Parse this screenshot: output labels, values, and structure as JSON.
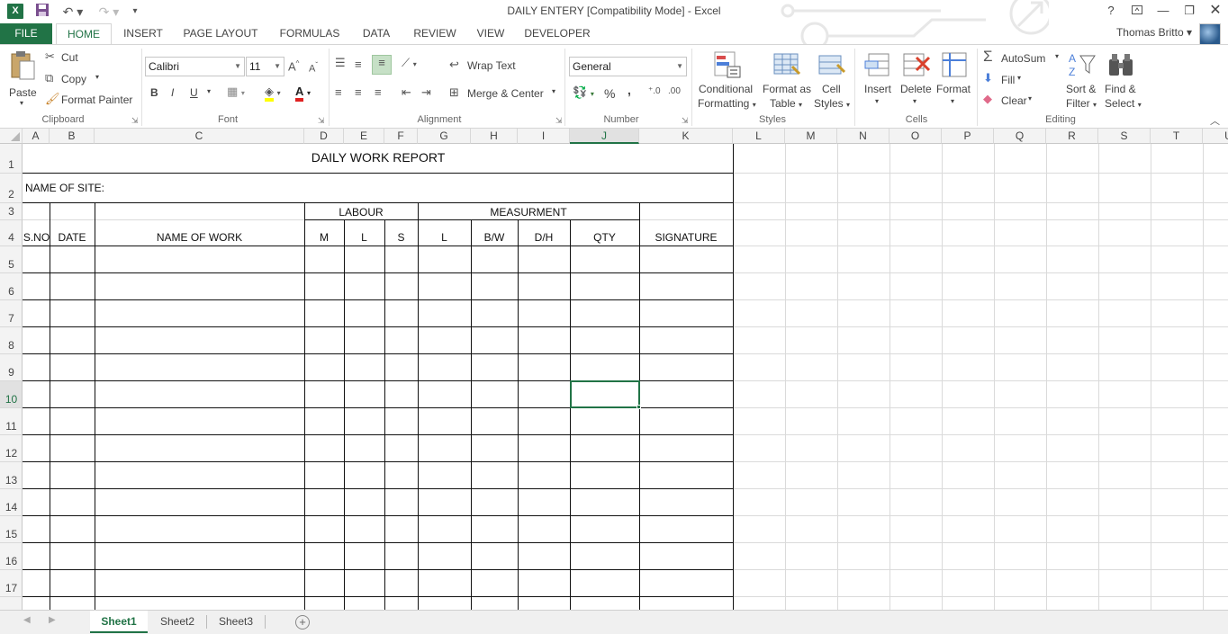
{
  "window": {
    "title": "DAILY ENTERY  [Compatibility Mode] - Excel",
    "user_name": "Thomas Britto",
    "help": "?",
    "logo_letter": "X"
  },
  "tabs": [
    "FILE",
    "HOME",
    "INSERT",
    "PAGE LAYOUT",
    "FORMULAS",
    "DATA",
    "REVIEW",
    "VIEW",
    "DEVELOPER"
  ],
  "ribbon": {
    "clipboard": {
      "label": "Clipboard",
      "paste": "Paste",
      "cut": "Cut",
      "copy": "Copy",
      "format_painter": "Format Painter"
    },
    "font": {
      "label": "Font",
      "name": "Calibri",
      "size": "11",
      "bold": "B",
      "italic": "I",
      "underline": "U"
    },
    "alignment": {
      "label": "Alignment",
      "wrap": "Wrap Text",
      "merge": "Merge & Center"
    },
    "number": {
      "label": "Number",
      "format": "General",
      "percent": "%",
      "comma": ","
    },
    "styles": {
      "label": "Styles",
      "cond1": "Conditional",
      "cond2": "Formatting",
      "table1": "Format as",
      "table2": "Table",
      "cell1": "Cell",
      "cell2": "Styles"
    },
    "cells": {
      "label": "Cells",
      "insert": "Insert",
      "delete": "Delete",
      "format": "Format"
    },
    "editing": {
      "label": "Editing",
      "autosum": "AutoSum",
      "fill": "Fill",
      "clear": "Clear",
      "sort1": "Sort &",
      "sort2": "Filter",
      "find1": "Find &",
      "find2": "Select"
    }
  },
  "grid": {
    "columns": [
      "A",
      "B",
      "C",
      "D",
      "E",
      "F",
      "G",
      "H",
      "I",
      "J",
      "K",
      "L",
      "M",
      "N",
      "O",
      "P",
      "Q",
      "R",
      "S",
      "T",
      "U"
    ],
    "rows": [
      "1",
      "2",
      "3",
      "4",
      "5",
      "6",
      "7",
      "8",
      "9",
      "10",
      "11",
      "12",
      "13",
      "14",
      "15",
      "16",
      "17"
    ],
    "selected_cell": "J10",
    "cells": {
      "title": "DAILY WORK REPORT",
      "site": "NAME OF SITE:",
      "labour": "LABOUR",
      "measurement": "MEASURMENT",
      "sno": "S.NO",
      "date": "DATE",
      "name_of_work": "NAME OF WORK",
      "m": "M",
      "l1": "L",
      "s": "S",
      "l2": "L",
      "bw": "B/W",
      "dh": "D/H",
      "qty": "QTY",
      "signature": "SIGNATURE"
    }
  },
  "sheets": [
    "Sheet1",
    "Sheet2",
    "Sheet3"
  ],
  "active_sheet": "Sheet1",
  "colors": {
    "accent": "#217346"
  }
}
